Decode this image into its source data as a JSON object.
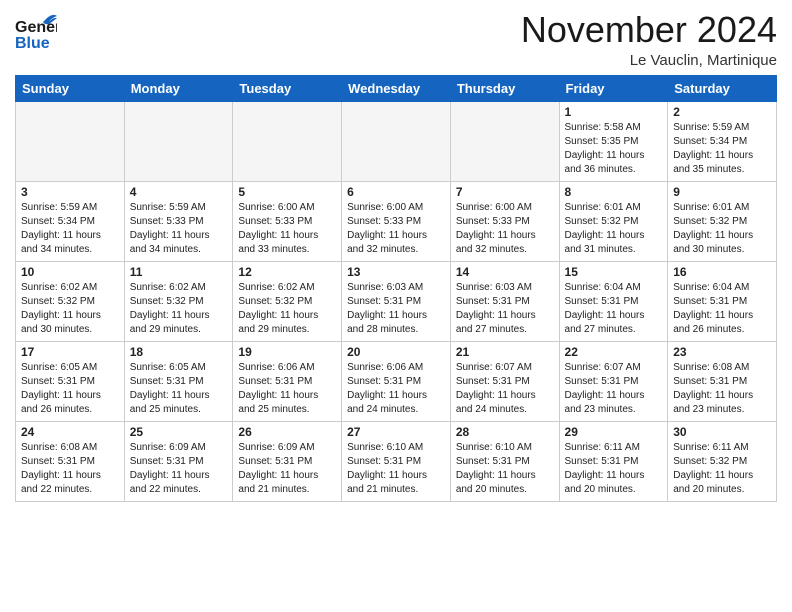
{
  "header": {
    "logo_line1": "General",
    "logo_line2": "Blue",
    "month": "November 2024",
    "location": "Le Vauclin, Martinique"
  },
  "weekdays": [
    "Sunday",
    "Monday",
    "Tuesday",
    "Wednesday",
    "Thursday",
    "Friday",
    "Saturday"
  ],
  "weeks": [
    [
      {
        "day": "",
        "info": ""
      },
      {
        "day": "",
        "info": ""
      },
      {
        "day": "",
        "info": ""
      },
      {
        "day": "",
        "info": ""
      },
      {
        "day": "",
        "info": ""
      },
      {
        "day": "1",
        "info": "Sunrise: 5:58 AM\nSunset: 5:35 PM\nDaylight: 11 hours\nand 36 minutes."
      },
      {
        "day": "2",
        "info": "Sunrise: 5:59 AM\nSunset: 5:34 PM\nDaylight: 11 hours\nand 35 minutes."
      }
    ],
    [
      {
        "day": "3",
        "info": "Sunrise: 5:59 AM\nSunset: 5:34 PM\nDaylight: 11 hours\nand 34 minutes."
      },
      {
        "day": "4",
        "info": "Sunrise: 5:59 AM\nSunset: 5:33 PM\nDaylight: 11 hours\nand 34 minutes."
      },
      {
        "day": "5",
        "info": "Sunrise: 6:00 AM\nSunset: 5:33 PM\nDaylight: 11 hours\nand 33 minutes."
      },
      {
        "day": "6",
        "info": "Sunrise: 6:00 AM\nSunset: 5:33 PM\nDaylight: 11 hours\nand 32 minutes."
      },
      {
        "day": "7",
        "info": "Sunrise: 6:00 AM\nSunset: 5:33 PM\nDaylight: 11 hours\nand 32 minutes."
      },
      {
        "day": "8",
        "info": "Sunrise: 6:01 AM\nSunset: 5:32 PM\nDaylight: 11 hours\nand 31 minutes."
      },
      {
        "day": "9",
        "info": "Sunrise: 6:01 AM\nSunset: 5:32 PM\nDaylight: 11 hours\nand 30 minutes."
      }
    ],
    [
      {
        "day": "10",
        "info": "Sunrise: 6:02 AM\nSunset: 5:32 PM\nDaylight: 11 hours\nand 30 minutes."
      },
      {
        "day": "11",
        "info": "Sunrise: 6:02 AM\nSunset: 5:32 PM\nDaylight: 11 hours\nand 29 minutes."
      },
      {
        "day": "12",
        "info": "Sunrise: 6:02 AM\nSunset: 5:32 PM\nDaylight: 11 hours\nand 29 minutes."
      },
      {
        "day": "13",
        "info": "Sunrise: 6:03 AM\nSunset: 5:31 PM\nDaylight: 11 hours\nand 28 minutes."
      },
      {
        "day": "14",
        "info": "Sunrise: 6:03 AM\nSunset: 5:31 PM\nDaylight: 11 hours\nand 27 minutes."
      },
      {
        "day": "15",
        "info": "Sunrise: 6:04 AM\nSunset: 5:31 PM\nDaylight: 11 hours\nand 27 minutes."
      },
      {
        "day": "16",
        "info": "Sunrise: 6:04 AM\nSunset: 5:31 PM\nDaylight: 11 hours\nand 26 minutes."
      }
    ],
    [
      {
        "day": "17",
        "info": "Sunrise: 6:05 AM\nSunset: 5:31 PM\nDaylight: 11 hours\nand 26 minutes."
      },
      {
        "day": "18",
        "info": "Sunrise: 6:05 AM\nSunset: 5:31 PM\nDaylight: 11 hours\nand 25 minutes."
      },
      {
        "day": "19",
        "info": "Sunrise: 6:06 AM\nSunset: 5:31 PM\nDaylight: 11 hours\nand 25 minutes."
      },
      {
        "day": "20",
        "info": "Sunrise: 6:06 AM\nSunset: 5:31 PM\nDaylight: 11 hours\nand 24 minutes."
      },
      {
        "day": "21",
        "info": "Sunrise: 6:07 AM\nSunset: 5:31 PM\nDaylight: 11 hours\nand 24 minutes."
      },
      {
        "day": "22",
        "info": "Sunrise: 6:07 AM\nSunset: 5:31 PM\nDaylight: 11 hours\nand 23 minutes."
      },
      {
        "day": "23",
        "info": "Sunrise: 6:08 AM\nSunset: 5:31 PM\nDaylight: 11 hours\nand 23 minutes."
      }
    ],
    [
      {
        "day": "24",
        "info": "Sunrise: 6:08 AM\nSunset: 5:31 PM\nDaylight: 11 hours\nand 22 minutes."
      },
      {
        "day": "25",
        "info": "Sunrise: 6:09 AM\nSunset: 5:31 PM\nDaylight: 11 hours\nand 22 minutes."
      },
      {
        "day": "26",
        "info": "Sunrise: 6:09 AM\nSunset: 5:31 PM\nDaylight: 11 hours\nand 21 minutes."
      },
      {
        "day": "27",
        "info": "Sunrise: 6:10 AM\nSunset: 5:31 PM\nDaylight: 11 hours\nand 21 minutes."
      },
      {
        "day": "28",
        "info": "Sunrise: 6:10 AM\nSunset: 5:31 PM\nDaylight: 11 hours\nand 20 minutes."
      },
      {
        "day": "29",
        "info": "Sunrise: 6:11 AM\nSunset: 5:31 PM\nDaylight: 11 hours\nand 20 minutes."
      },
      {
        "day": "30",
        "info": "Sunrise: 6:11 AM\nSunset: 5:32 PM\nDaylight: 11 hours\nand 20 minutes."
      }
    ]
  ]
}
